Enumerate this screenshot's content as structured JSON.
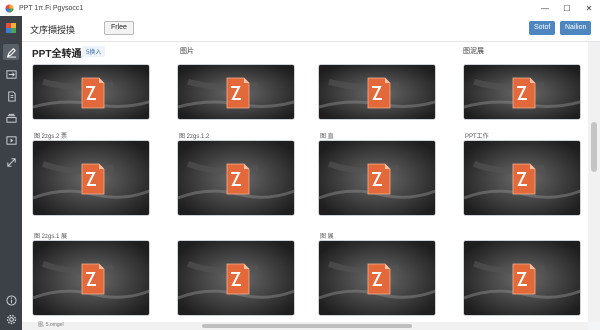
{
  "window": {
    "title": "PPT 1π.Fi Pgysocc1",
    "minimize": "—",
    "maximize": "☐",
    "close": "✕"
  },
  "toolbar": {
    "title": "文序擷授換",
    "free_button": "Frlee",
    "btn_sort": "Sotof",
    "btn_nailion": "Nailion"
  },
  "sidebar": {
    "items": [
      "logo-icon",
      "edit-icon",
      "convert-icon",
      "document-icon",
      "stack-icon",
      "slideshow-icon",
      "expand-icon",
      "info-icon",
      "settings-icon"
    ]
  },
  "columns": {
    "main": "PPT全转通",
    "badge": "5换入",
    "c2": "图片",
    "c3": "",
    "c4": "图泥展"
  },
  "rows": [
    {
      "captions": [
        "",
        "",
        "",
        ""
      ]
    },
    {
      "captions": [
        "图 2zgs.2 票",
        "图 2zgs.1.2",
        "图      直",
        "PPT工作"
      ]
    },
    {
      "captions": [
        "图 2zgs.1 展",
        "",
        "图      展",
        ""
      ]
    }
  ],
  "status": "图, 5.omgel",
  "colors": {
    "sidebar": "#3c4148",
    "accent": "#4e86bf",
    "icon_orange": "#e3693a"
  }
}
